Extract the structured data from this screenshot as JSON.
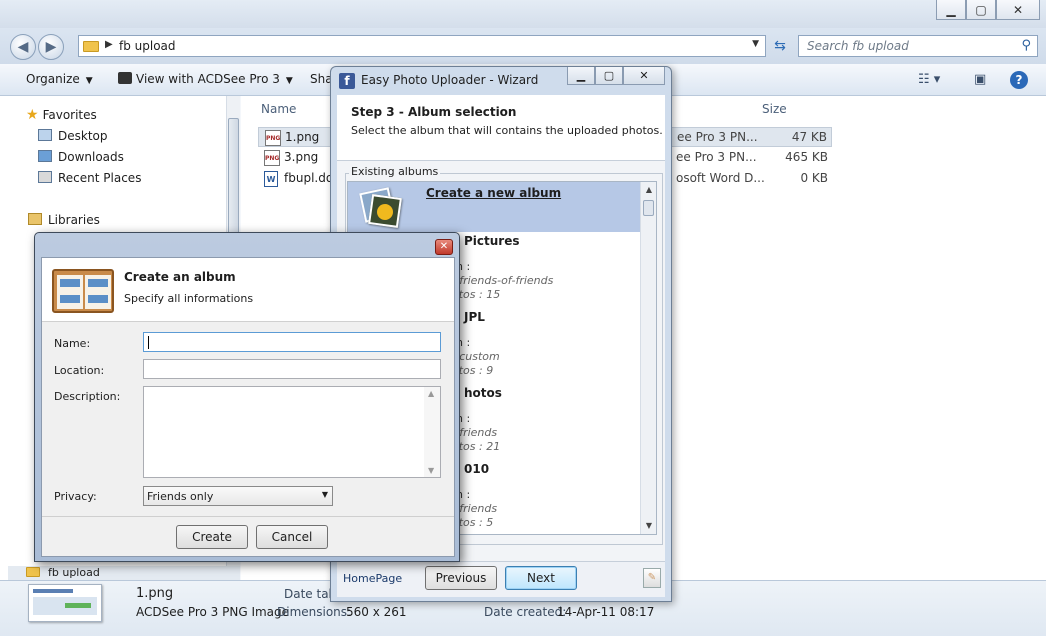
{
  "explorer": {
    "address": {
      "crumb": "fb upload"
    },
    "search": {
      "placeholder": "Search fb upload"
    },
    "toolbar": {
      "organize": "Organize",
      "view_with": "View with ACDSee Pro 3",
      "share": "Sha"
    },
    "nav": {
      "favorites": "Favorites",
      "desktop": "Desktop",
      "downloads": "Downloads",
      "recent": "Recent Places",
      "libraries": "Libraries",
      "fb_upload": "fb upload"
    },
    "columns": {
      "name": "Name",
      "size": "Size"
    },
    "files": [
      {
        "name": "1.png",
        "type": "ee Pro 3 PN...",
        "size": "47 KB",
        "selected": true,
        "icon": "png-file-icon"
      },
      {
        "name": "3.png",
        "type": "ee Pro 3 PN...",
        "size": "465 KB",
        "selected": false,
        "icon": "png-file-icon"
      },
      {
        "name": "fbupl.do",
        "type": "osoft Word D...",
        "size": "0 KB",
        "selected": false,
        "icon": "word-file-icon"
      }
    ],
    "details": {
      "filename": "1.png",
      "filetype": "ACDSee Pro 3 PNG Image",
      "date_taken_label": "Date take",
      "dimensions_label": "Dimensions:",
      "dimensions": "560 x 261",
      "date_created_label": "Date created:",
      "date_created": "14-Apr-11 08:17"
    }
  },
  "wizard": {
    "title": "Easy Photo Uploader - Wizard",
    "step": "Step 3 - Album selection",
    "subtitle": "Select the album that will contains the uploaded photos.",
    "group_label": "Existing albums",
    "create_new": "Create a new album",
    "albums": [
      {
        "title": "Pictures",
        "colon": "n :",
        "privacy": ": friends-of-friends",
        "photos": "otos : 15"
      },
      {
        "title": "JPL",
        "colon": "n :",
        "privacy": ": custom",
        "photos": "otos : 9"
      },
      {
        "title": "hotos",
        "colon": "n :",
        "privacy": ": friends",
        "photos": "otos : 21"
      },
      {
        "title": "010",
        "colon": "n :",
        "privacy": ": friends",
        "photos": "otos : 5"
      }
    ],
    "homepage": "HomePage",
    "previous": "Previous",
    "next": "Next"
  },
  "dialog": {
    "title": "Create an album",
    "subtitle": "Specify all informations",
    "name_label": "Name:",
    "location_label": "Location:",
    "description_label": "Description:",
    "privacy_label": "Privacy:",
    "privacy_value": "Friends only",
    "create": "Create",
    "cancel": "Cancel"
  },
  "colors": {
    "accent": "#3c7fb1",
    "selection": "#b6c8e6",
    "facebook": "#3b5998"
  }
}
